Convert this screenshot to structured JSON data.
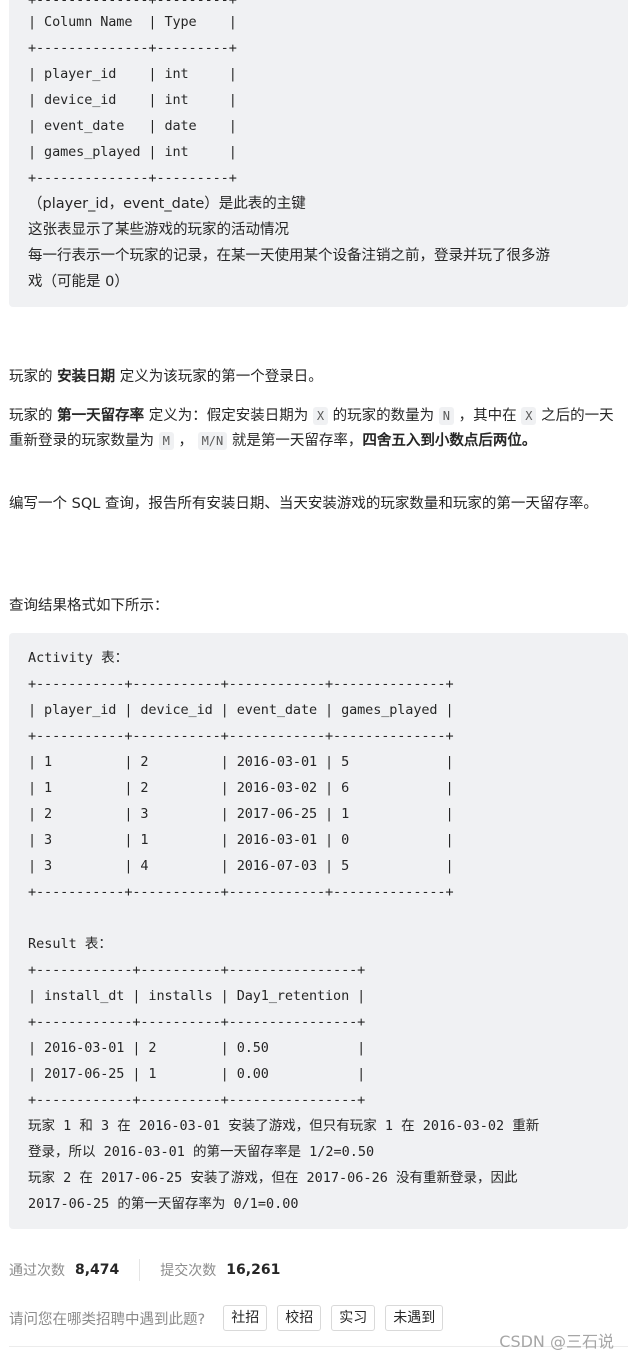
{
  "schema_block": {
    "lines": [
      "| Column Name  | Type    |",
      "+--------------+---------+",
      "| player_id    | int     |",
      "| device_id    | int     |",
      "| event_date   | date    |",
      "| games_played | int     |",
      "+--------------+---------+"
    ],
    "columns": [
      {
        "name": "player_id",
        "type": "int"
      },
      {
        "name": "device_id",
        "type": "int"
      },
      {
        "name": "event_date",
        "type": "date"
      },
      {
        "name": "games_played",
        "type": "int"
      }
    ],
    "notes": [
      "（player_id，event_date）是此表的主键",
      "这张表显示了某些游戏的玩家的活动情况",
      "每一行表示一个玩家的记录，在某一天使用某个设备注销之前，登录并玩了很多游",
      "戏（可能是 0）"
    ]
  },
  "description": {
    "install_def": {
      "prefix": "玩家的 ",
      "term": "安装日期",
      "suffix": " 定义为该玩家的第一个登录日。"
    },
    "retention_def": {
      "p1": "玩家的 ",
      "term": "第一天留存率",
      "p2": " 定义为：假定安装日期为 ",
      "code_x": "X",
      "p3": " 的玩家的数量为 ",
      "code_n": "N",
      "p4": " ，其中在 ",
      "code_x2": "X",
      "p5": " 之后的一天重新登录的玩家数量为 ",
      "code_m": "M",
      "p6": " ， ",
      "code_mn": "M/N",
      "p7": " 就是第一天留存率，",
      "bold_end": "四舍五入到小数点后两位。"
    },
    "task": "编写一个 SQL 查询，报告所有安装日期、当天安装游戏的玩家数量和玩家的第一天留存率。",
    "format_intro": "查询结果格式如下所示："
  },
  "example_block": {
    "activity_title": "Activity 表：",
    "activity_lines": [
      "+-----------+-----------+------------+--------------+",
      "| player_id | device_id | event_date | games_played |",
      "+-----------+-----------+------------+--------------+",
      "| 1         | 2         | 2016-03-01 | 5            |",
      "| 1         | 2         | 2016-03-02 | 6            |",
      "| 2         | 3         | 2017-06-25 | 1            |",
      "| 3         | 1         | 2016-03-01 | 0            |",
      "| 3         | 4         | 2016-07-03 | 5            |",
      "+-----------+-----------+------------+--------------+"
    ],
    "activity_table": {
      "headers": [
        "player_id",
        "device_id",
        "event_date",
        "games_played"
      ],
      "rows": [
        [
          "1",
          "2",
          "2016-03-01",
          "5"
        ],
        [
          "1",
          "2",
          "2016-03-02",
          "6"
        ],
        [
          "2",
          "3",
          "2017-06-25",
          "1"
        ],
        [
          "3",
          "1",
          "2016-03-01",
          "0"
        ],
        [
          "3",
          "4",
          "2016-07-03",
          "5"
        ]
      ]
    },
    "result_title": "Result 表：",
    "result_lines": [
      "+------------+----------+----------------+",
      "| install_dt | installs | Day1_retention |",
      "+------------+----------+----------------+",
      "| 2016-03-01 | 2        | 0.50           |",
      "| 2017-06-25 | 1        | 0.00           |",
      "+------------+----------+----------------+"
    ],
    "result_table": {
      "headers": [
        "install_dt",
        "installs",
        "Day1_retention"
      ],
      "rows": [
        [
          "2016-03-01",
          "2",
          "0.50"
        ],
        [
          "2017-06-25",
          "1",
          "0.00"
        ]
      ]
    },
    "explanation_lines": [
      "玩家 1 和 3 在 2016-03-01 安装了游戏，但只有玩家 1 在 2016-03-02 重新",
      "登录，所以 2016-03-01 的第一天留存率是 1/2=0.50",
      "玩家 2 在 2017-06-25 安装了游戏，但在 2017-06-26 没有重新登录，因此",
      "2017-06-25 的第一天留存率为 0/1=0.00"
    ]
  },
  "stats": {
    "accepted_label": "通过次数",
    "accepted_value": "8,474",
    "submitted_label": "提交次数",
    "submitted_value": "16,261"
  },
  "survey": {
    "question": "请问您在哪类招聘中遇到此题?",
    "options": [
      "社招",
      "校招",
      "实习",
      "未遇到"
    ]
  },
  "watermark": "CSDN @三石说"
}
